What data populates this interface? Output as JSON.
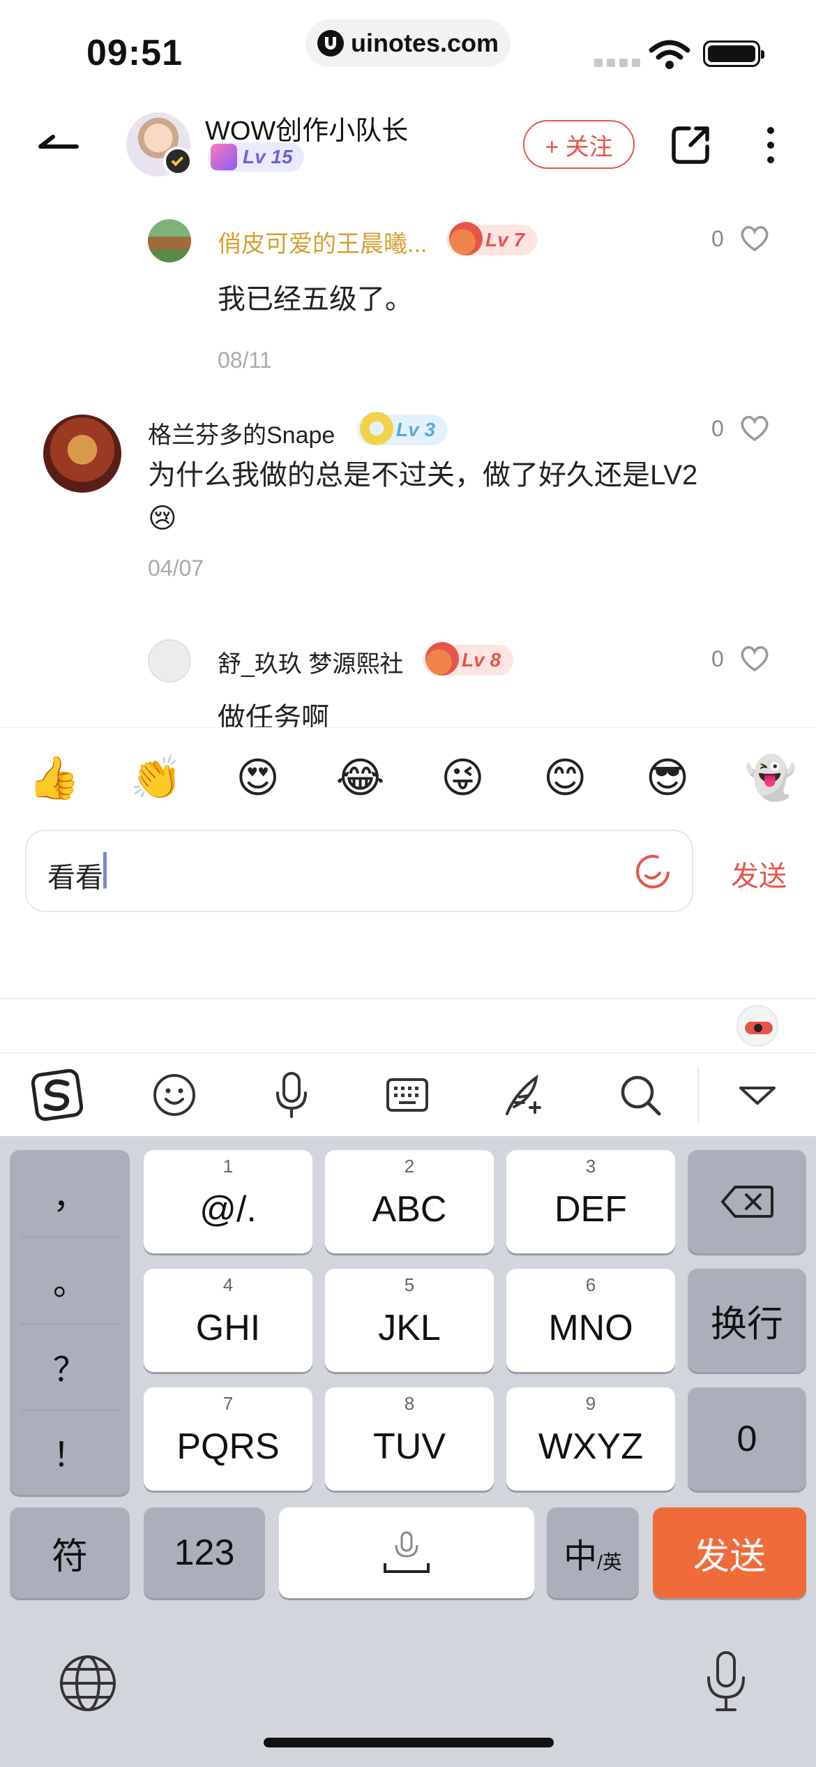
{
  "status_bar": {
    "time": "09:51",
    "url": "uinotes.com"
  },
  "header": {
    "user_name": "WOW创作小队长",
    "level": "Lv 15",
    "follow_label": "+ 关注"
  },
  "comments": [
    {
      "user": "俏皮可爱的王晨曦...",
      "level": "Lv 7",
      "text": "我已经五级了。",
      "date": "08/11",
      "likes": "0"
    },
    {
      "user": "格兰芬多的Snape",
      "level": "Lv 3",
      "text": "为什么我做的总是不过关，做了好久还是LV2",
      "emoji": "😢",
      "date": "04/07",
      "likes": "0"
    },
    {
      "user": "舒_玖玖 梦源熙社",
      "level": "Lv 8",
      "text": "做任务啊",
      "likes": "0"
    }
  ],
  "emoji_bar": [
    "👍",
    "👏",
    "😍",
    "😂",
    "😜",
    "😊",
    "😎",
    "👻"
  ],
  "composer": {
    "input_value": "看看",
    "send_label": "发送"
  },
  "keyboard": {
    "punctuation": [
      "，",
      "。",
      "？",
      "！"
    ],
    "rows": [
      [
        {
          "num": "1",
          "label": "@/."
        },
        {
          "num": "2",
          "label": "ABC"
        },
        {
          "num": "3",
          "label": "DEF"
        }
      ],
      [
        {
          "num": "4",
          "label": "GHI"
        },
        {
          "num": "5",
          "label": "JKL"
        },
        {
          "num": "6",
          "label": "MNO"
        }
      ],
      [
        {
          "num": "7",
          "label": "PQRS"
        },
        {
          "num": "8",
          "label": "TUV"
        },
        {
          "num": "9",
          "label": "WXYZ"
        }
      ]
    ],
    "newline_label": "换行",
    "zero_label": "0",
    "symbols_label": "符",
    "numbers_label": "123",
    "lang_main": "中",
    "lang_sub": "/英",
    "send_label": "发送"
  },
  "colors": {
    "accent": "#e8544a",
    "send_key": "#f06b3a",
    "keyboard_bg": "#d3d5dd",
    "gold_name": "#d4a030",
    "level_blue": "#5aa6e0"
  }
}
